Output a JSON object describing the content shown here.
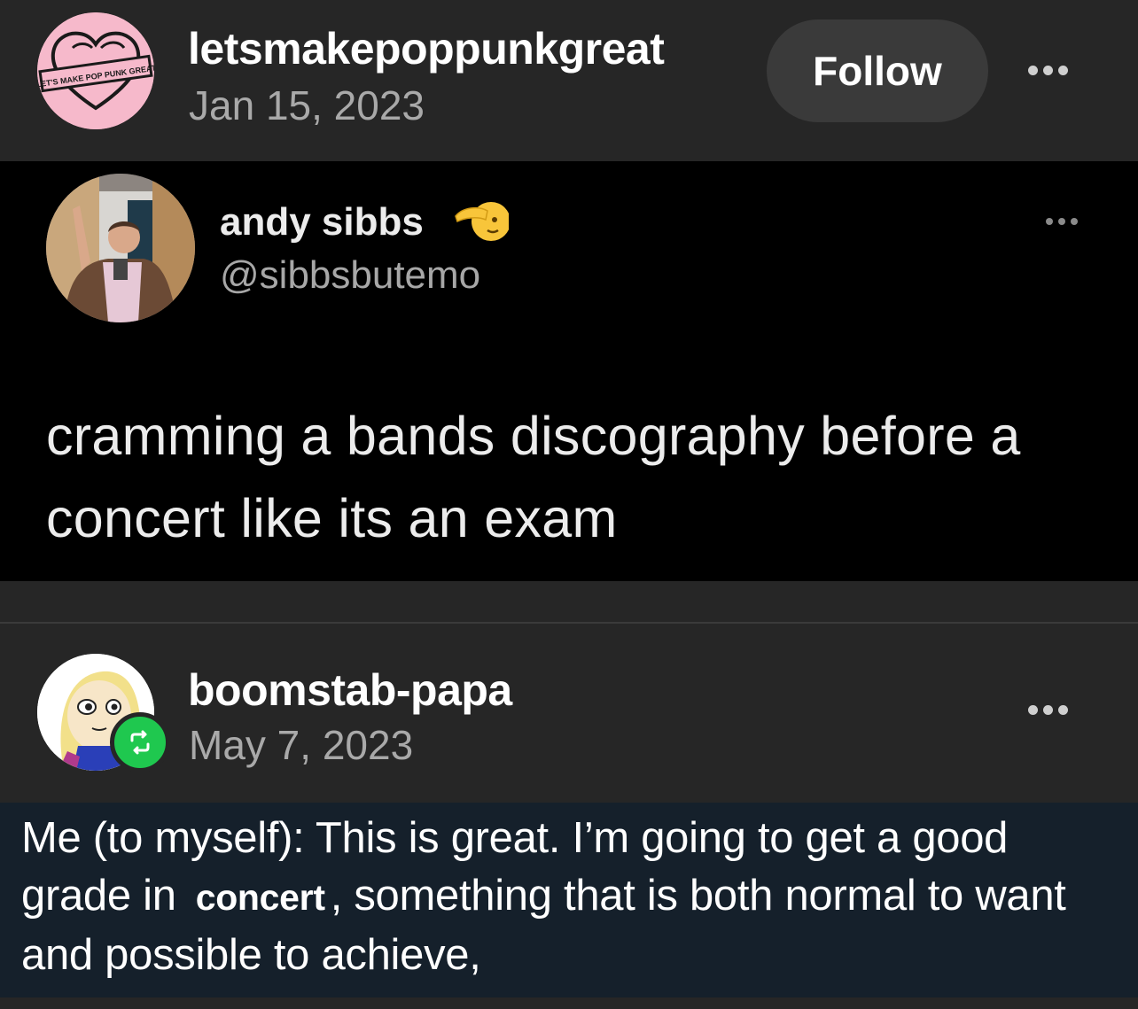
{
  "post1": {
    "username": "letsmakepoppunkgreat",
    "date": "Jan 15, 2023",
    "follow_label": "Follow",
    "avatar_banner_text": "LET'S MAKE POP PUNK GREAT"
  },
  "tweet": {
    "display_name": "andy sibbs",
    "handle": "@sibbsbutemo",
    "emoji": "salute-face-emoji",
    "text": "cramming a bands discography before a concert like its an exam"
  },
  "post2": {
    "username": "boomstab-papa",
    "date": "May 7, 2023",
    "reblog_icon": "reblog-icon"
  },
  "quote": {
    "part1": "Me (to myself): This is great. I’m going to get a good grade in",
    "inserted_word": "concert",
    "part2": ", something that is both normal to want and possible to achieve,"
  },
  "colors": {
    "post_background": "#262626",
    "tweet_background": "#000000",
    "quote_background": "#15202b",
    "reblog_green": "#1fc84f",
    "avatar_pink": "#f6b9cb"
  }
}
